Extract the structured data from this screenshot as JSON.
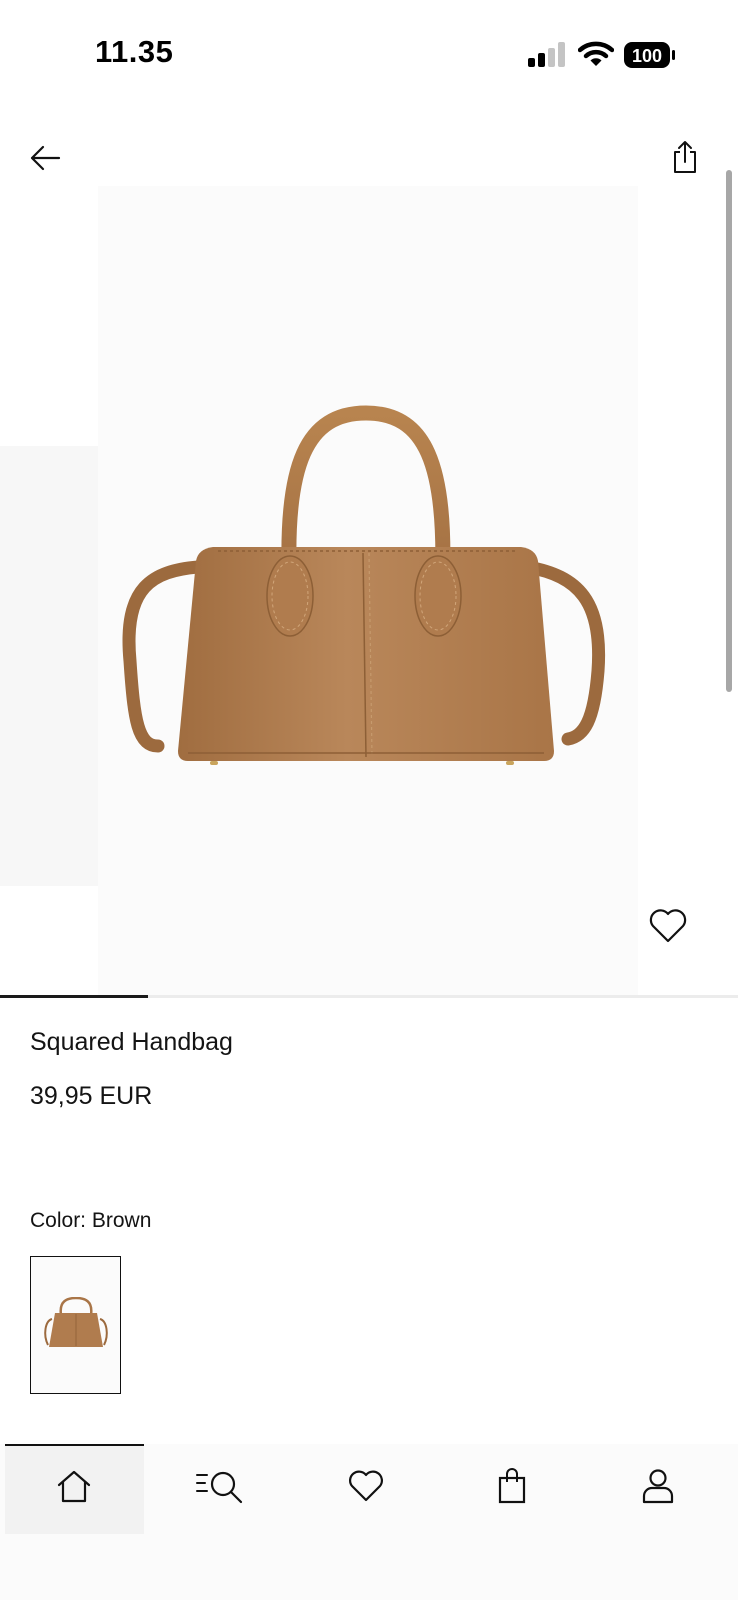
{
  "status_bar": {
    "time": "11.35",
    "battery": "100"
  },
  "top_nav": {
    "back_icon": "arrow-left-icon",
    "share_icon": "share-icon"
  },
  "gallery": {
    "image": "brown-squared-handbag",
    "image_index": 1,
    "progress": 0.2,
    "wishlist_icon": "heart-outline-icon"
  },
  "product": {
    "name": "Squared Handbag",
    "price": "39,95 EUR",
    "color_label": "Color: Brown",
    "swatches": [
      {
        "color": "Brown",
        "selected": true
      }
    ]
  },
  "bottom_nav": {
    "items": [
      {
        "icon": "home-icon",
        "active": true
      },
      {
        "icon": "search-menu-icon",
        "active": false
      },
      {
        "icon": "heart-icon",
        "active": false
      },
      {
        "icon": "shopping-bag-icon",
        "active": false
      },
      {
        "icon": "profile-icon",
        "active": false
      }
    ]
  },
  "colors": {
    "accent": "#111111",
    "leather": "#B07C4E"
  }
}
